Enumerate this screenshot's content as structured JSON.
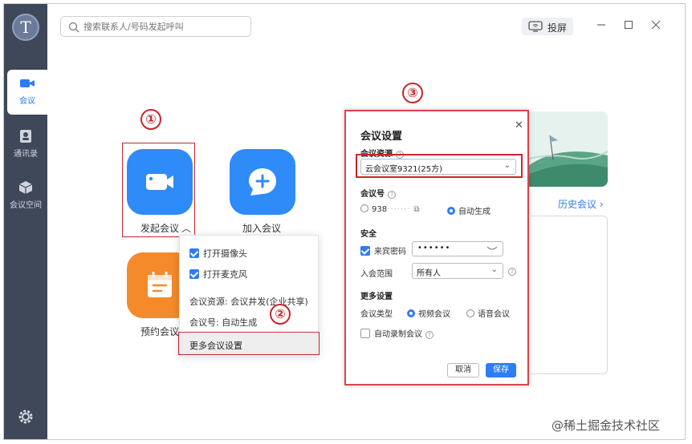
{
  "app": {
    "logo_letter": "T"
  },
  "sidebar": {
    "items": [
      {
        "label": "会议",
        "icon": "video-camera-icon",
        "active": true
      },
      {
        "label": "通讯录",
        "icon": "contacts-icon",
        "active": false
      },
      {
        "label": "会议空间",
        "icon": "cube-icon",
        "active": false
      }
    ],
    "settings_icon": "gear-icon"
  },
  "topbar": {
    "search_placeholder": "搜索联系人/号码发起呼叫",
    "cast_label": "投屏"
  },
  "tiles": {
    "start": "发起会议",
    "join": "加入会议",
    "schedule": "预约会议"
  },
  "dropdown": {
    "camera": "打开摄像头",
    "mic": "打开麦克风",
    "resource": "会议资源: 会议井发(企业共享)",
    "number": "会议号: 自动生成",
    "more": "更多会议设置"
  },
  "annotations": [
    "①",
    "②",
    "③"
  ],
  "right_panel": {
    "history": "历史会议 ›"
  },
  "modal": {
    "title": "会议设置",
    "resource_label": "会议资源",
    "resource_value": "云会议室9321(25方)",
    "number_label": "会议号",
    "number_opt1": "938",
    "number_opt2": "自动生成",
    "security_label": "安全",
    "password_label": "来宾密码",
    "password_value": "••••••",
    "scope_label": "入会范围",
    "scope_value": "所有人",
    "more_label": "更多设置",
    "type_label": "会议类型",
    "type_video": "视频会议",
    "type_voice": "语音会议",
    "auto_record": "自动录制会议",
    "cancel": "取消",
    "save": "保存"
  },
  "watermark": "@稀土掘金技术社区",
  "colors": {
    "accent": "#2e7cf6",
    "sidebar": "#3f4859",
    "annotation": "#c7262d",
    "orange": "#f48a2a"
  }
}
